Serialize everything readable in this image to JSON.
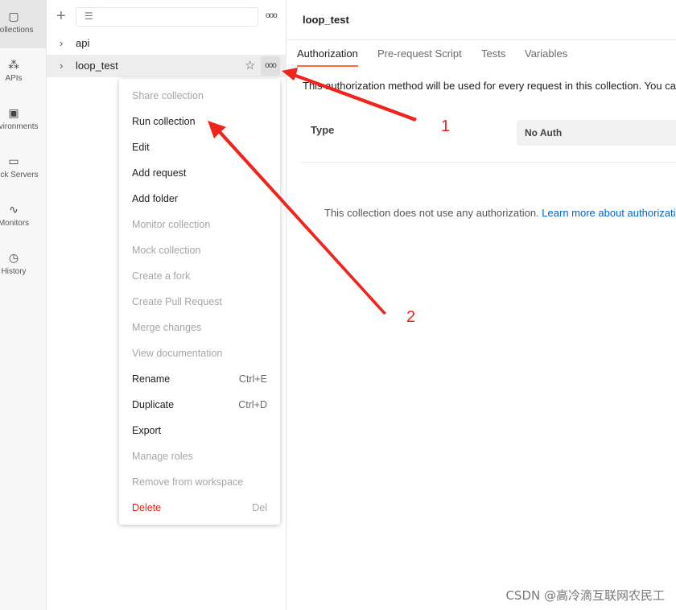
{
  "rail": [
    {
      "label": "Collections",
      "icon": "collections-icon",
      "active": true
    },
    {
      "label": "APIs",
      "icon": "apis-icon"
    },
    {
      "label": "Environments",
      "icon": "environments-icon"
    },
    {
      "label": "Mock Servers",
      "icon": "mock-servers-icon"
    },
    {
      "label": "Monitors",
      "icon": "monitors-icon"
    },
    {
      "label": "History",
      "icon": "history-icon"
    }
  ],
  "sidebar": {
    "items": [
      {
        "label": "api"
      },
      {
        "label": "loop_test"
      }
    ]
  },
  "menu": [
    {
      "label": "Share collection",
      "disabled": true
    },
    {
      "label": "Run collection"
    },
    {
      "label": "Edit"
    },
    {
      "label": "Add request"
    },
    {
      "label": "Add folder"
    },
    {
      "label": "Monitor collection",
      "disabled": true
    },
    {
      "label": "Mock collection",
      "disabled": true
    },
    {
      "label": "Create a fork",
      "disabled": true
    },
    {
      "label": "Create Pull Request",
      "disabled": true
    },
    {
      "label": "Merge changes",
      "disabled": true
    },
    {
      "label": "View documentation",
      "disabled": true
    },
    {
      "label": "Rename",
      "shortcut": "Ctrl+E"
    },
    {
      "label": "Duplicate",
      "shortcut": "Ctrl+D"
    },
    {
      "label": "Export"
    },
    {
      "label": "Manage roles",
      "disabled": true
    },
    {
      "label": "Remove from workspace",
      "disabled": true
    },
    {
      "label": "Delete",
      "shortcut": "Del",
      "danger": true
    }
  ],
  "main": {
    "title": "loop_test",
    "tabs": [
      "Authorization",
      "Pre-request Script",
      "Tests",
      "Variables"
    ],
    "description": "This authorization method will be used for every request in this collection. You can",
    "type_label": "Type",
    "type_value": "No Auth",
    "no_auth_text": "This collection does not use any authorization.",
    "learn_more": "Learn more about authorization"
  },
  "annotations": {
    "label1": "1",
    "label2": "2",
    "color": "#f2231a"
  },
  "watermark": "CSDN @高冷滴互联网农民工",
  "colors": {
    "accent": "#ff6c37",
    "link": "#0265d2",
    "danger": "#eb2013"
  }
}
